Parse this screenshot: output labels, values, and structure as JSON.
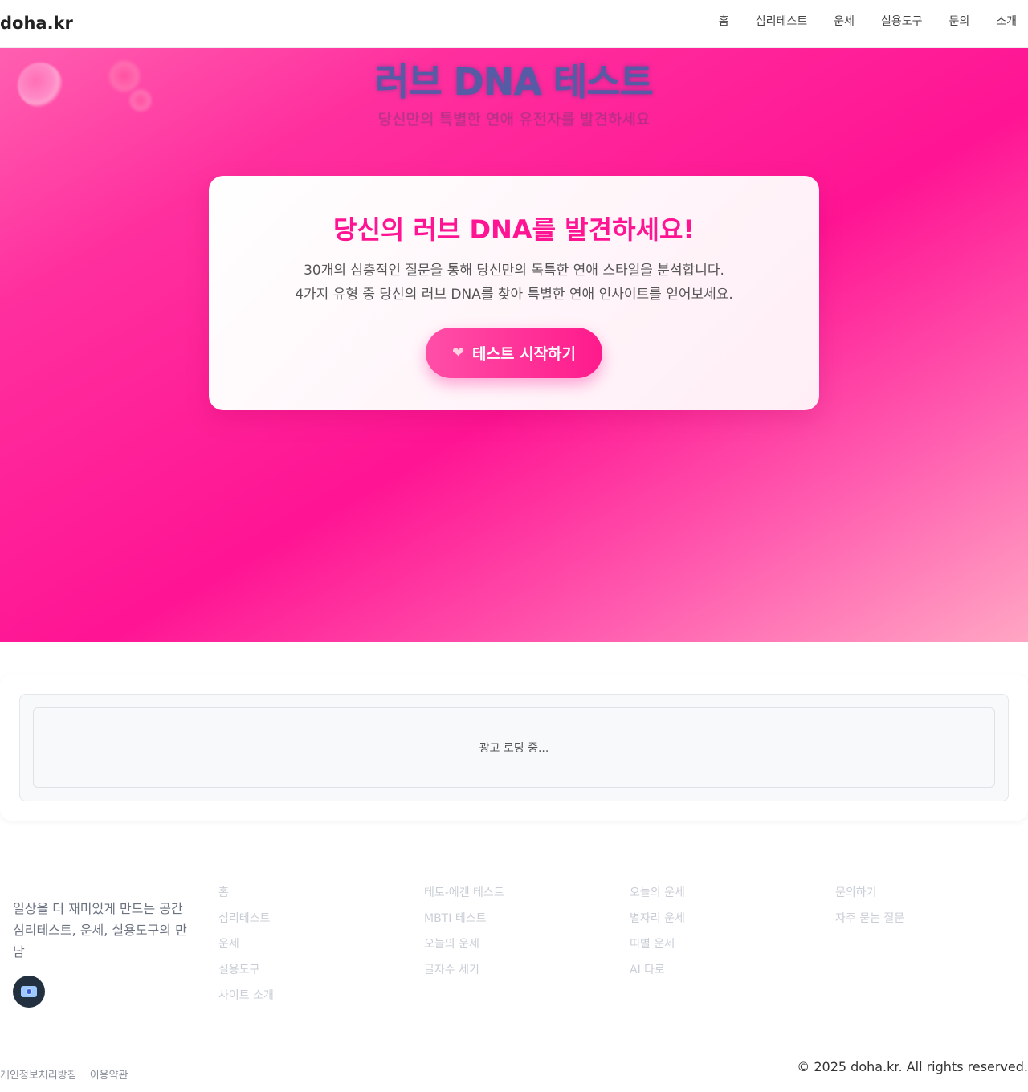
{
  "header": {
    "logo": "doha.kr",
    "nav": [
      "홈",
      "심리테스트",
      "운세",
      "실용도구",
      "문의",
      "소개"
    ]
  },
  "hero": {
    "title": "러브 DNA 테스트",
    "subtitle": "당신만의 특별한 연애 유전자를 발견하세요",
    "card": {
      "heading": "당신의 러브 DNA를 발견하세요!",
      "desc_line1": "30개의 심층적인 질문을 통해 당신만의 독특한 연애 스타일을 분석합니다.",
      "desc_line2": "4가지 유형 중 당신의 러브 DNA를 찾아 특별한 연애 인사이트를 얻어보세요.",
      "button_label": "테스트 시작하기",
      "button_icon": "sparkling-heart-icon"
    }
  },
  "ad": {
    "loading_text": "광고 로딩 중..."
  },
  "footer": {
    "description": "일상을 더 재미있게 만드는 공간 심리테스트, 운세, 실용도구의 만남",
    "columns": [
      [
        "홈",
        "심리테스트",
        "운세",
        "실용도구",
        "사이트 소개"
      ],
      [
        "테토-에겐 테스트",
        "MBTI 테스트",
        "오늘의 운세",
        "글자수 세기"
      ],
      [
        "오늘의 운세",
        "별자리 운세",
        "띠별 운세",
        "AI 타로"
      ],
      [
        "문의하기",
        "자주 묻는 질문"
      ]
    ],
    "legal": [
      "개인정보처리방침",
      "이용약관"
    ],
    "copyright": "© 2025 doha.kr. All rights reserved."
  },
  "colors": {
    "accent": "#ff1493",
    "hero_title": "#4e5ea6",
    "footer_icon_bg": "#22303f"
  }
}
